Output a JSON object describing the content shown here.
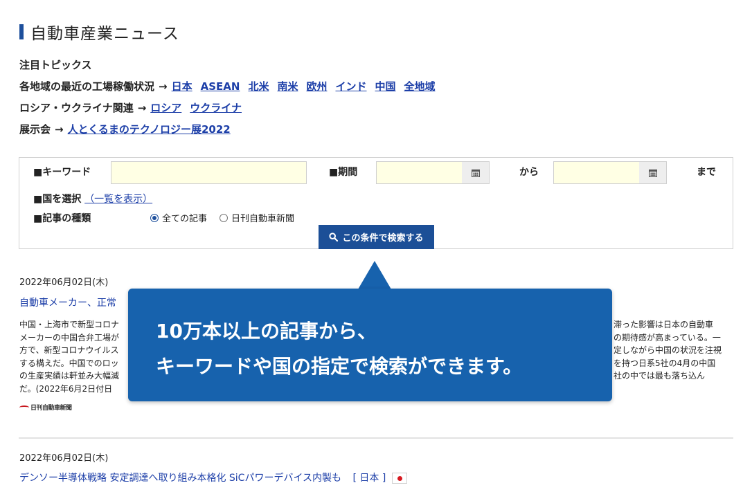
{
  "page": {
    "title": "自動車産業ニュース"
  },
  "topics": {
    "heading": "注目トピックス",
    "rows": [
      {
        "label": "各地域の最近の工場稼働状況",
        "arrow": "→",
        "links": [
          "日本",
          "ASEAN",
          "北米",
          "南米",
          "欧州",
          "インド",
          "中国",
          "全地域"
        ]
      },
      {
        "label": "ロシア・ウクライナ関連",
        "arrow": "→",
        "links": [
          "ロシア",
          "ウクライナ"
        ]
      },
      {
        "label": "展示会",
        "arrow": "→",
        "links": [
          "人とくるまのテクノロジー展2022"
        ]
      }
    ]
  },
  "search": {
    "keyword_label": "■キーワード",
    "keyword_value": "",
    "period_label": "■期間",
    "from_label": "から",
    "to_label": "まで",
    "from_value": "",
    "to_value": "",
    "country_label": "■国を選択",
    "country_link": "（一覧を表示）",
    "type_label": "■記事の種類",
    "type_options": [
      {
        "label": "全ての記事",
        "checked": true
      },
      {
        "label": "日刊自動車新聞",
        "checked": false
      }
    ],
    "button_label": "この条件で検索する",
    "button_icon": "search-icon"
  },
  "articles": [
    {
      "date": "2022年06月02日(木)",
      "title": "自動車メーカー、正常",
      "body_left": "中国・上海市で新型コロナ\nメーカーの中国合弁工場が\n方で、新型コロナウイルス\nする構えだ。中国でのロッ\nの生産実績は軒並み大幅減\nだ。(2022年6月2日付日",
      "body_right": "滞った影響は日本の自動車\nの期待感が高まっている。一\n定しながら中国の状況を注視\nを持つ日系5社の4月の中国\n社の中では最も落ち込ん",
      "source_logo": "日刊自動車新聞"
    },
    {
      "date": "2022年06月02日(木)",
      "title": "デンソー半導体戦略 安定調達へ取り組み本格化 SiCパワーデバイス内製も",
      "country": "[ 日本 ]",
      "flag": "japan-flag"
    }
  ],
  "callout": {
    "line1": "10万本以上の記事から、",
    "line2": "キーワードや国の指定で検索ができます。"
  },
  "colors": {
    "accent": "#1d4f9c",
    "link": "#1d3fa8",
    "callout_bg": "#1762ad",
    "input_bg": "#ffffe4"
  }
}
